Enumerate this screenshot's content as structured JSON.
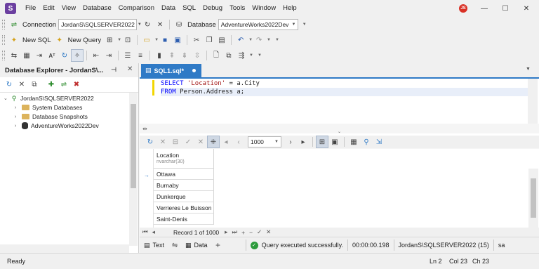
{
  "app": {
    "logo": "S",
    "user_initials": "JS"
  },
  "menu": [
    "File",
    "Edit",
    "View",
    "Database",
    "Comparison",
    "Data",
    "SQL",
    "Debug",
    "Tools",
    "Window",
    "Help"
  ],
  "window_controls": {
    "minimize": "—",
    "maximize": "☐",
    "close": "✕"
  },
  "toolbar1": {
    "connection_label": "Connection",
    "connection_value": "JordanS\\SQLSERVER2022",
    "database_label": "Database",
    "database_value": "AdventureWorks2022Dev"
  },
  "toolbar2": {
    "new_sql": "New SQL",
    "new_query": "New Query"
  },
  "explorer": {
    "title": "Database Explorer - JordanS\\...",
    "pin_icon": "⊣",
    "close_icon": "✕",
    "tree": {
      "server": "JordanS\\SQLSERVER2022",
      "children": [
        "System Databases",
        "Database Snapshots",
        "AdventureWorks2022Dev"
      ]
    }
  },
  "editor": {
    "tab_title": "SQL1.sql*",
    "lines": [
      {
        "kw1": "SELECT",
        "str": "'Location'",
        "op": " = ",
        "rest": "a.City"
      },
      {
        "kw1": "FROM",
        "rest": " Person.Address a;"
      }
    ]
  },
  "results_toolbar": {
    "page_size": "1000"
  },
  "grid": {
    "column": {
      "name": "Location",
      "type": "nvarchar(30)"
    },
    "rows": [
      "Ottawa",
      "Burnaby",
      "Dunkerque",
      "Verrieres Le Buisson",
      "Saint-Denis"
    ]
  },
  "record_nav": {
    "text": "Record 1 of 1000"
  },
  "bottom": {
    "text_tab": "Text",
    "data_tab": "Data",
    "add": "+",
    "status": "Query executed successfully.",
    "elapsed": "00:00:00.198",
    "server": "JordanS\\SQLSERVER2022 (15)",
    "user": "sa"
  },
  "statusbar": {
    "ready": "Ready",
    "ln": "Ln 2",
    "col": "Col 23",
    "ch": "Ch 23"
  },
  "colors": {
    "accent": "#2f7ac6",
    "keyword": "#0000ff",
    "string": "#a31515",
    "success": "#2b9a3b",
    "logo": "#6b3fa0"
  }
}
